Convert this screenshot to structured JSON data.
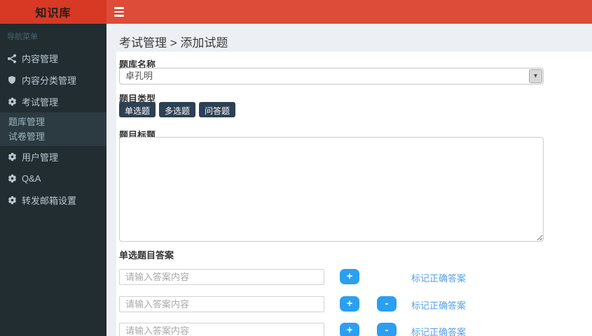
{
  "app": {
    "logo": "知识库"
  },
  "icons": {
    "dropdown_arrow": "▼"
  },
  "sidebar": {
    "header": "导航菜单",
    "items": [
      {
        "label": "内容管理",
        "icon": "share-nodes"
      },
      {
        "label": "内容分类管理",
        "icon": "shield"
      },
      {
        "label": "考试管理",
        "icon": "gear",
        "expanded": true,
        "children": [
          "题库管理",
          "试卷管理"
        ]
      },
      {
        "label": "用户管理",
        "icon": "gear"
      },
      {
        "label": "Q&A",
        "icon": "gear"
      },
      {
        "label": "转发邮箱设置",
        "icon": "gear"
      }
    ]
  },
  "breadcrumb": "考试管理 > 添加试题",
  "form": {
    "bank_label": "题库名称",
    "bank_value": "卓孔明",
    "type_label": "题目类型",
    "type_buttons": [
      "单选题",
      "多选题",
      "问答题"
    ],
    "title_label": "题目标题",
    "title_value": "",
    "answers_label": "单选题目答案",
    "answer_placeholder": "请输入答案内容",
    "answer_values": [
      "",
      "",
      ""
    ],
    "add_label": "+",
    "remove_label": "-",
    "mark_correct_label": "标记正确答案"
  },
  "colors": {
    "navbar_red": "#dd4b39",
    "logo_red": "#d73925",
    "sidebar_dark": "#222d32",
    "submenu_dark": "#2c3b41",
    "page_bg": "#ecf0f5",
    "type_button_dark": "#2e4154",
    "action_blue": "#2b9ff0",
    "link_blue": "#53a0ee"
  }
}
